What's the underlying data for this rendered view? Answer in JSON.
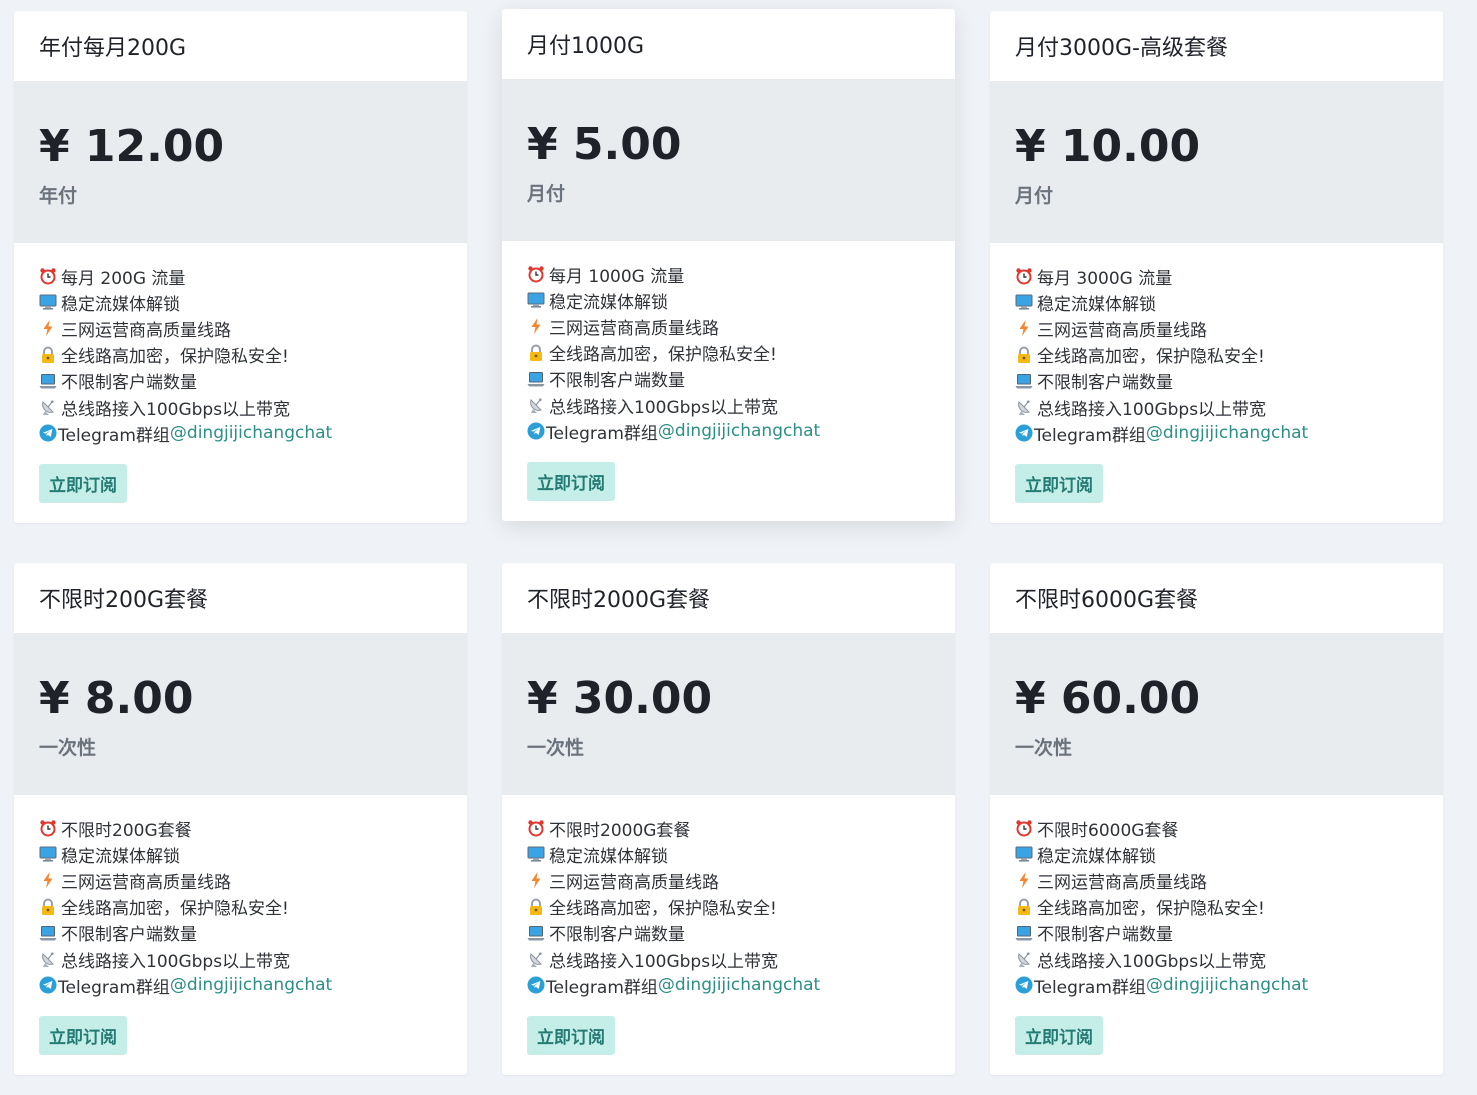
{
  "plans": [
    {
      "title": "年付每月200G",
      "price": "¥ 12.00",
      "period": "年付",
      "features": [
        "每月 200G 流量",
        "稳定流媒体解锁",
        "三网运营商高质量线路",
        "全线路高加密，保护隐私安全!",
        "不限制客户端数量",
        "总线路接入100Gbps以上带宽"
      ],
      "telegram_prefix": "Telegram群组",
      "telegram_link": "@dingjijichangchat",
      "button": "立即订阅"
    },
    {
      "title": "月付1000G",
      "price": "¥ 5.00",
      "period": "月付",
      "features": [
        "每月 1000G 流量",
        "稳定流媒体解锁",
        "三网运营商高质量线路",
        "全线路高加密，保护隐私安全!",
        "不限制客户端数量",
        "总线路接入100Gbps以上带宽"
      ],
      "telegram_prefix": "Telegram群组",
      "telegram_link": "@dingjijichangchat",
      "button": "立即订阅"
    },
    {
      "title": "月付3000G-高级套餐",
      "price": "¥ 10.00",
      "period": "月付",
      "features": [
        "每月 3000G 流量",
        "稳定流媒体解锁",
        "三网运营商高质量线路",
        "全线路高加密，保护隐私安全!",
        "不限制客户端数量",
        "总线路接入100Gbps以上带宽"
      ],
      "telegram_prefix": "Telegram群组",
      "telegram_link": "@dingjijichangchat",
      "button": "立即订阅"
    },
    {
      "title": "不限时200G套餐",
      "price": "¥ 8.00",
      "period": "一次性",
      "features": [
        "不限时200G套餐",
        "稳定流媒体解锁",
        "三网运营商高质量线路",
        "全线路高加密，保护隐私安全!",
        "不限制客户端数量",
        "总线路接入100Gbps以上带宽"
      ],
      "telegram_prefix": "Telegram群组",
      "telegram_link": "@dingjijichangchat",
      "button": "立即订阅"
    },
    {
      "title": "不限时2000G套餐",
      "price": "¥ 30.00",
      "period": "一次性",
      "features": [
        "不限时2000G套餐",
        "稳定流媒体解锁",
        "三网运营商高质量线路",
        "全线路高加密，保护隐私安全!",
        "不限制客户端数量",
        "总线路接入100Gbps以上带宽"
      ],
      "telegram_prefix": "Telegram群组",
      "telegram_link": "@dingjijichangchat",
      "button": "立即订阅"
    },
    {
      "title": "不限时6000G套餐",
      "price": "¥ 60.00",
      "period": "一次性",
      "features": [
        "不限时6000G套餐",
        "稳定流媒体解锁",
        "三网运营商高质量线路",
        "全线路高加密，保护隐私安全!",
        "不限制客户端数量",
        "总线路接入100Gbps以上带宽"
      ],
      "telegram_prefix": "Telegram群组",
      "telegram_link": "@dingjijichangchat",
      "button": "立即订阅"
    }
  ],
  "icons": [
    "alarm-clock-icon",
    "desktop-computer-icon",
    "lightning-icon",
    "lock-icon",
    "laptop-icon",
    "satellite-antenna-icon",
    "telegram-icon"
  ],
  "colors": {
    "page_bg": "#eff2f6",
    "price_bg": "#e9ecef",
    "button_bg": "#c6eee9",
    "button_text": "#237b73",
    "link": "#2b8f86"
  }
}
